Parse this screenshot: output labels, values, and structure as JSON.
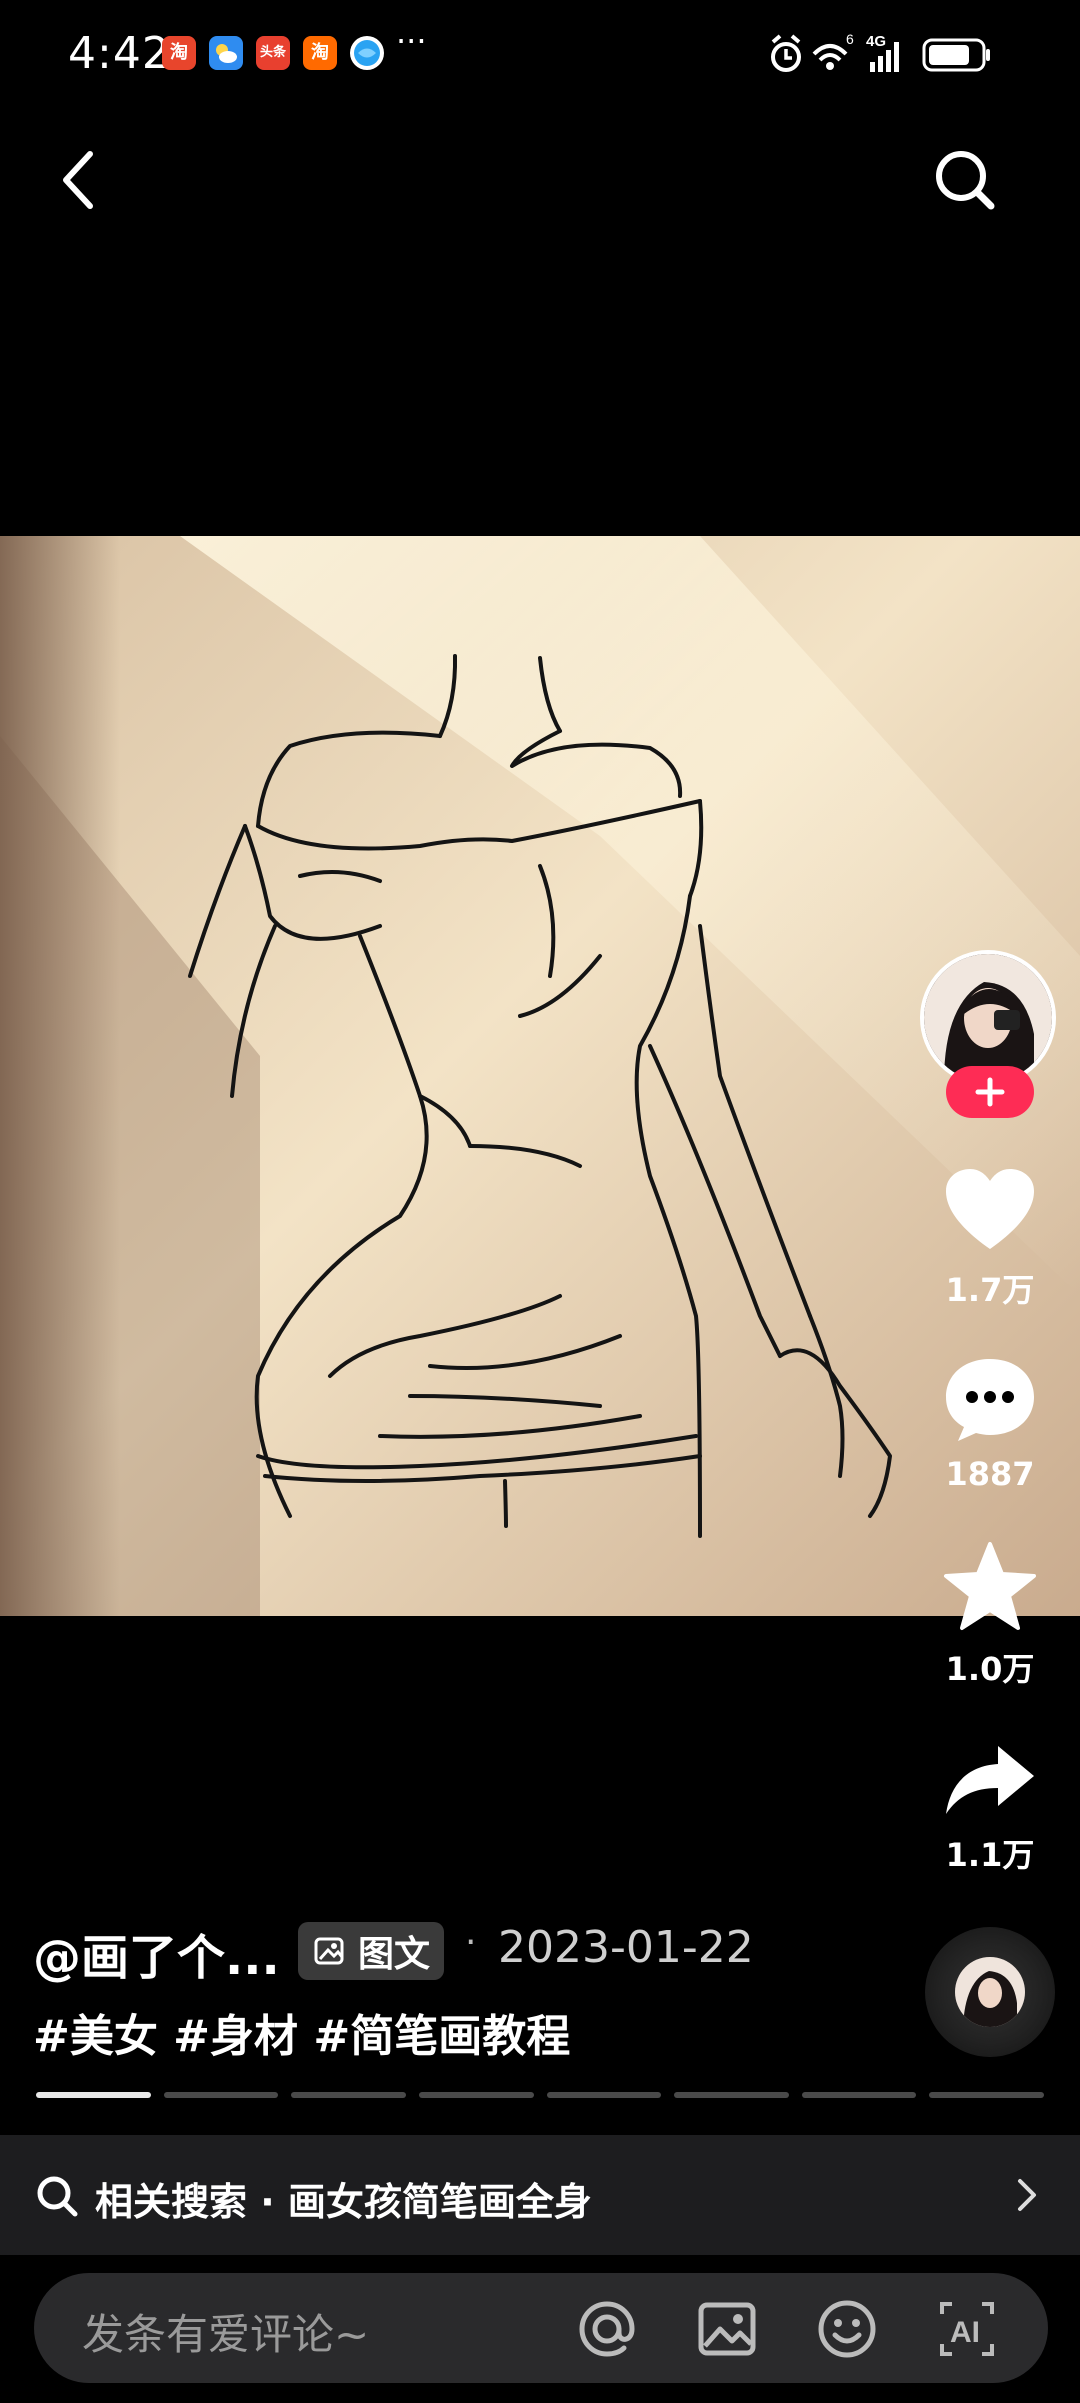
{
  "status_bar": {
    "time": "4:42",
    "notifications": [
      {
        "name": "taobao-icon",
        "label": "淘",
        "color": "#e8452c"
      },
      {
        "name": "weather-icon",
        "label": "",
        "color": "#2f8cf0"
      },
      {
        "name": "toutiao-icon",
        "label": "头条",
        "color": "#e8402f"
      },
      {
        "name": "taobao-icon-2",
        "label": "淘",
        "color": "#ff6a00"
      },
      {
        "name": "browser-icon",
        "label": "",
        "color": "#2aa3f2"
      }
    ],
    "more": "···",
    "network_label": "4G",
    "wifi_label": "6"
  },
  "actions": {
    "like_count": "1.7万",
    "comment_count": "1887",
    "favorite_count": "1.0万",
    "share_count": "1.1万"
  },
  "post": {
    "author": "@画了个...",
    "type_badge": "图文",
    "separator": "·",
    "date": "2023-01-22",
    "hashtags": "#美女 #身材 #简笔画教程"
  },
  "progress": {
    "segments": 8,
    "active_index": 0
  },
  "related_search": {
    "text": "相关搜索 · 画女孩简笔画全身"
  },
  "comment": {
    "placeholder": "发条有爱评论~"
  },
  "colors": {
    "accent": "#fe2c55",
    "background": "#000000"
  }
}
